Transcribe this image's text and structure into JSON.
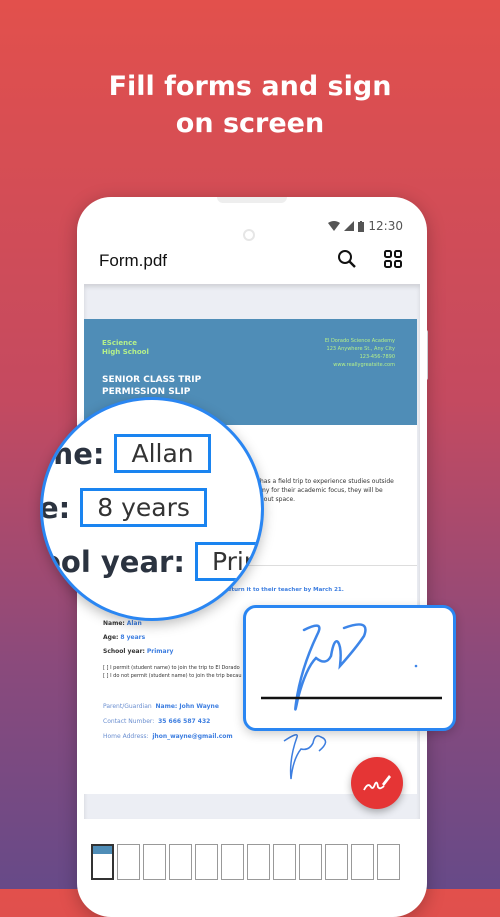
{
  "headline": [
    "Fill forms and sign",
    "on screen"
  ],
  "status": {
    "time": "12:30"
  },
  "appbar": {
    "title": "Form.pdf",
    "icons": [
      "search-icon",
      "grid-icon"
    ]
  },
  "document": {
    "school": [
      "EScience",
      "High School"
    ],
    "address": [
      "El Dorado Science Academy",
      "123 Anywhere St., Any City",
      "123-456-7890",
      "www.reallygreatsite.com"
    ],
    "slip_title": [
      "SENIOR CLASS TRIP",
      "PERMISSION SLIP"
    ],
    "intro": [
      "has a field trip to experience studies outside",
      "my for their academic focus, they will be",
      "bout space."
    ],
    "return_note": "return it to their teacher by March 21.",
    "fields": [
      {
        "label": "Name:",
        "value": "Alan"
      },
      {
        "label": "Age:",
        "value": "8 years"
      },
      {
        "label": "School year:",
        "value": "Primary"
      }
    ],
    "checkboxes": [
      "[ ] I permit (student name) to join the trip to El Dorado",
      "[ ] I do not permit (student name) to join the trip becau"
    ],
    "guardian": [
      {
        "label": "Parent/Guardian",
        "value": "Name: John Wayne"
      },
      {
        "label": "Contact Number:",
        "value": "35 666 587 432"
      },
      {
        "label": "Home Address:",
        "value": "jhon_wayne@gmail.com"
      }
    ]
  },
  "magnifier": [
    {
      "label": "me:",
      "value": "Allan"
    },
    {
      "label": "e:",
      "value": "8 years"
    },
    {
      "label": "ool year:",
      "value": "Prim"
    }
  ],
  "thumbnails": {
    "count": 12,
    "active": 0
  },
  "colors": {
    "accent": "#2a86f2",
    "fab": "#e53535",
    "header": "#4f8db7"
  }
}
